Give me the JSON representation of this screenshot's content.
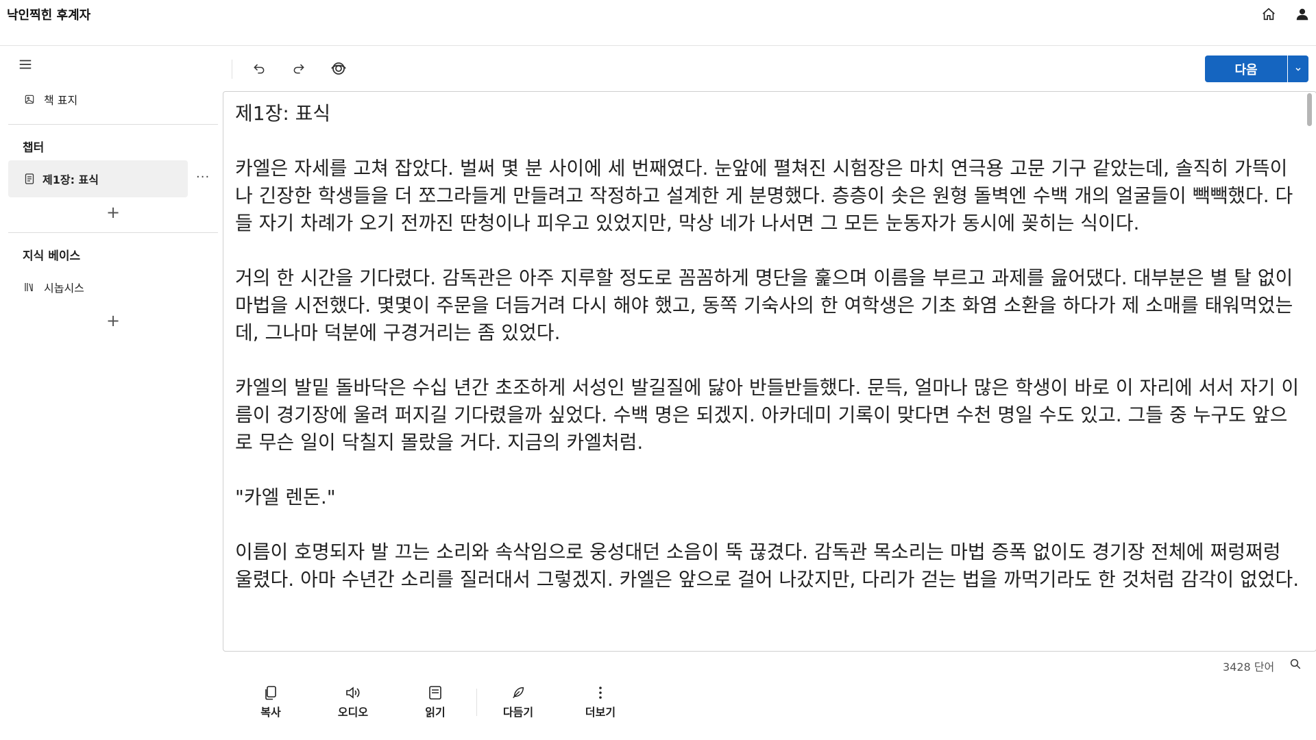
{
  "app": {
    "title": "낙인찍힌 후계자"
  },
  "topbar": {
    "icons": [
      "home-icon",
      "account-icon"
    ]
  },
  "sidebar": {
    "cover_label": "책 표지",
    "chapters_heading": "챕터",
    "chapters": [
      {
        "label": "제1장: 표식"
      }
    ],
    "more_symbol": "···",
    "add_symbol": "+",
    "knowledge_heading": "지식 베이스",
    "knowledge_items": [
      {
        "label": "시놉시스"
      }
    ]
  },
  "toolbar": {
    "icons": [
      "undo-icon",
      "redo-icon",
      "preview-icon"
    ],
    "next_label": "다음"
  },
  "editor": {
    "paragraphs": [
      "제1장: 표식",
      "카엘은 자세를 고쳐 잡았다. 벌써 몇 분 사이에 세 번째였다. 눈앞에 펼쳐진 시험장은 마치 연극용 고문 기구 같았는데, 솔직히 가뜩이나 긴장한 학생들을 더 쪼그라들게 만들려고 작정하고 설계한 게 분명했다. 층층이 솟은 원형 돌벽엔 수백 개의 얼굴들이 빽빽했다. 다들 자기 차례가 오기 전까진 딴청이나 피우고 있었지만, 막상 네가 나서면 그 모든 눈동자가 동시에 꽂히는 식이다.",
      "거의 한 시간을 기다렸다. 감독관은 아주 지루할 정도로 꼼꼼하게 명단을 훑으며 이름을 부르고 과제를 읊어댔다. 대부분은 별 탈 없이 마법을 시전했다. 몇몇이 주문을 더듬거려 다시 해야 했고, 동쪽 기숙사의 한 여학생은 기초 화염 소환을 하다가 제 소매를 태워먹었는데, 그나마 덕분에 구경거리는 좀 있었다.",
      "카엘의 발밑 돌바닥은 수십 년간 초조하게 서성인 발길질에 닳아 반들반들했다. 문득, 얼마나 많은 학생이 바로 이 자리에 서서 자기 이름이 경기장에 울려 퍼지길 기다렸을까 싶었다. 수백 명은 되겠지. 아카데미 기록이 맞다면 수천 명일 수도 있고. 그들 중 누구도 앞으로 무슨 일이 닥칠지 몰랐을 거다. 지금의 카엘처럼.",
      "\"카엘 렌돈.\"",
      "이름이 호명되자 발 끄는 소리와 속삭임으로 웅성대던 소음이 뚝 끊겼다. 감독관 목소리는 마법 증폭 없이도 경기장 전체에 쩌렁쩌렁 울렸다. 아마 수년간 소리를 질러대서 그렇겠지. 카엘은 앞으로 걸어 나갔지만, 다리가 걷는 법을 까먹기라도 한 것처럼 감각이 없었다."
    ]
  },
  "status": {
    "word_count": "3428 단어"
  },
  "bottom_actions": [
    {
      "label": "복사",
      "icon": "copy-icon"
    },
    {
      "label": "오디오",
      "icon": "audio-icon"
    },
    {
      "label": "읽기",
      "icon": "read-icon"
    },
    {
      "label": "다듬기",
      "icon": "refine-icon"
    },
    {
      "label": "더보기",
      "icon": "more-icon"
    }
  ],
  "colors": {
    "accent": "#1565c0",
    "border": "#cfcfcf",
    "selected_bg": "#f0f0f0"
  }
}
